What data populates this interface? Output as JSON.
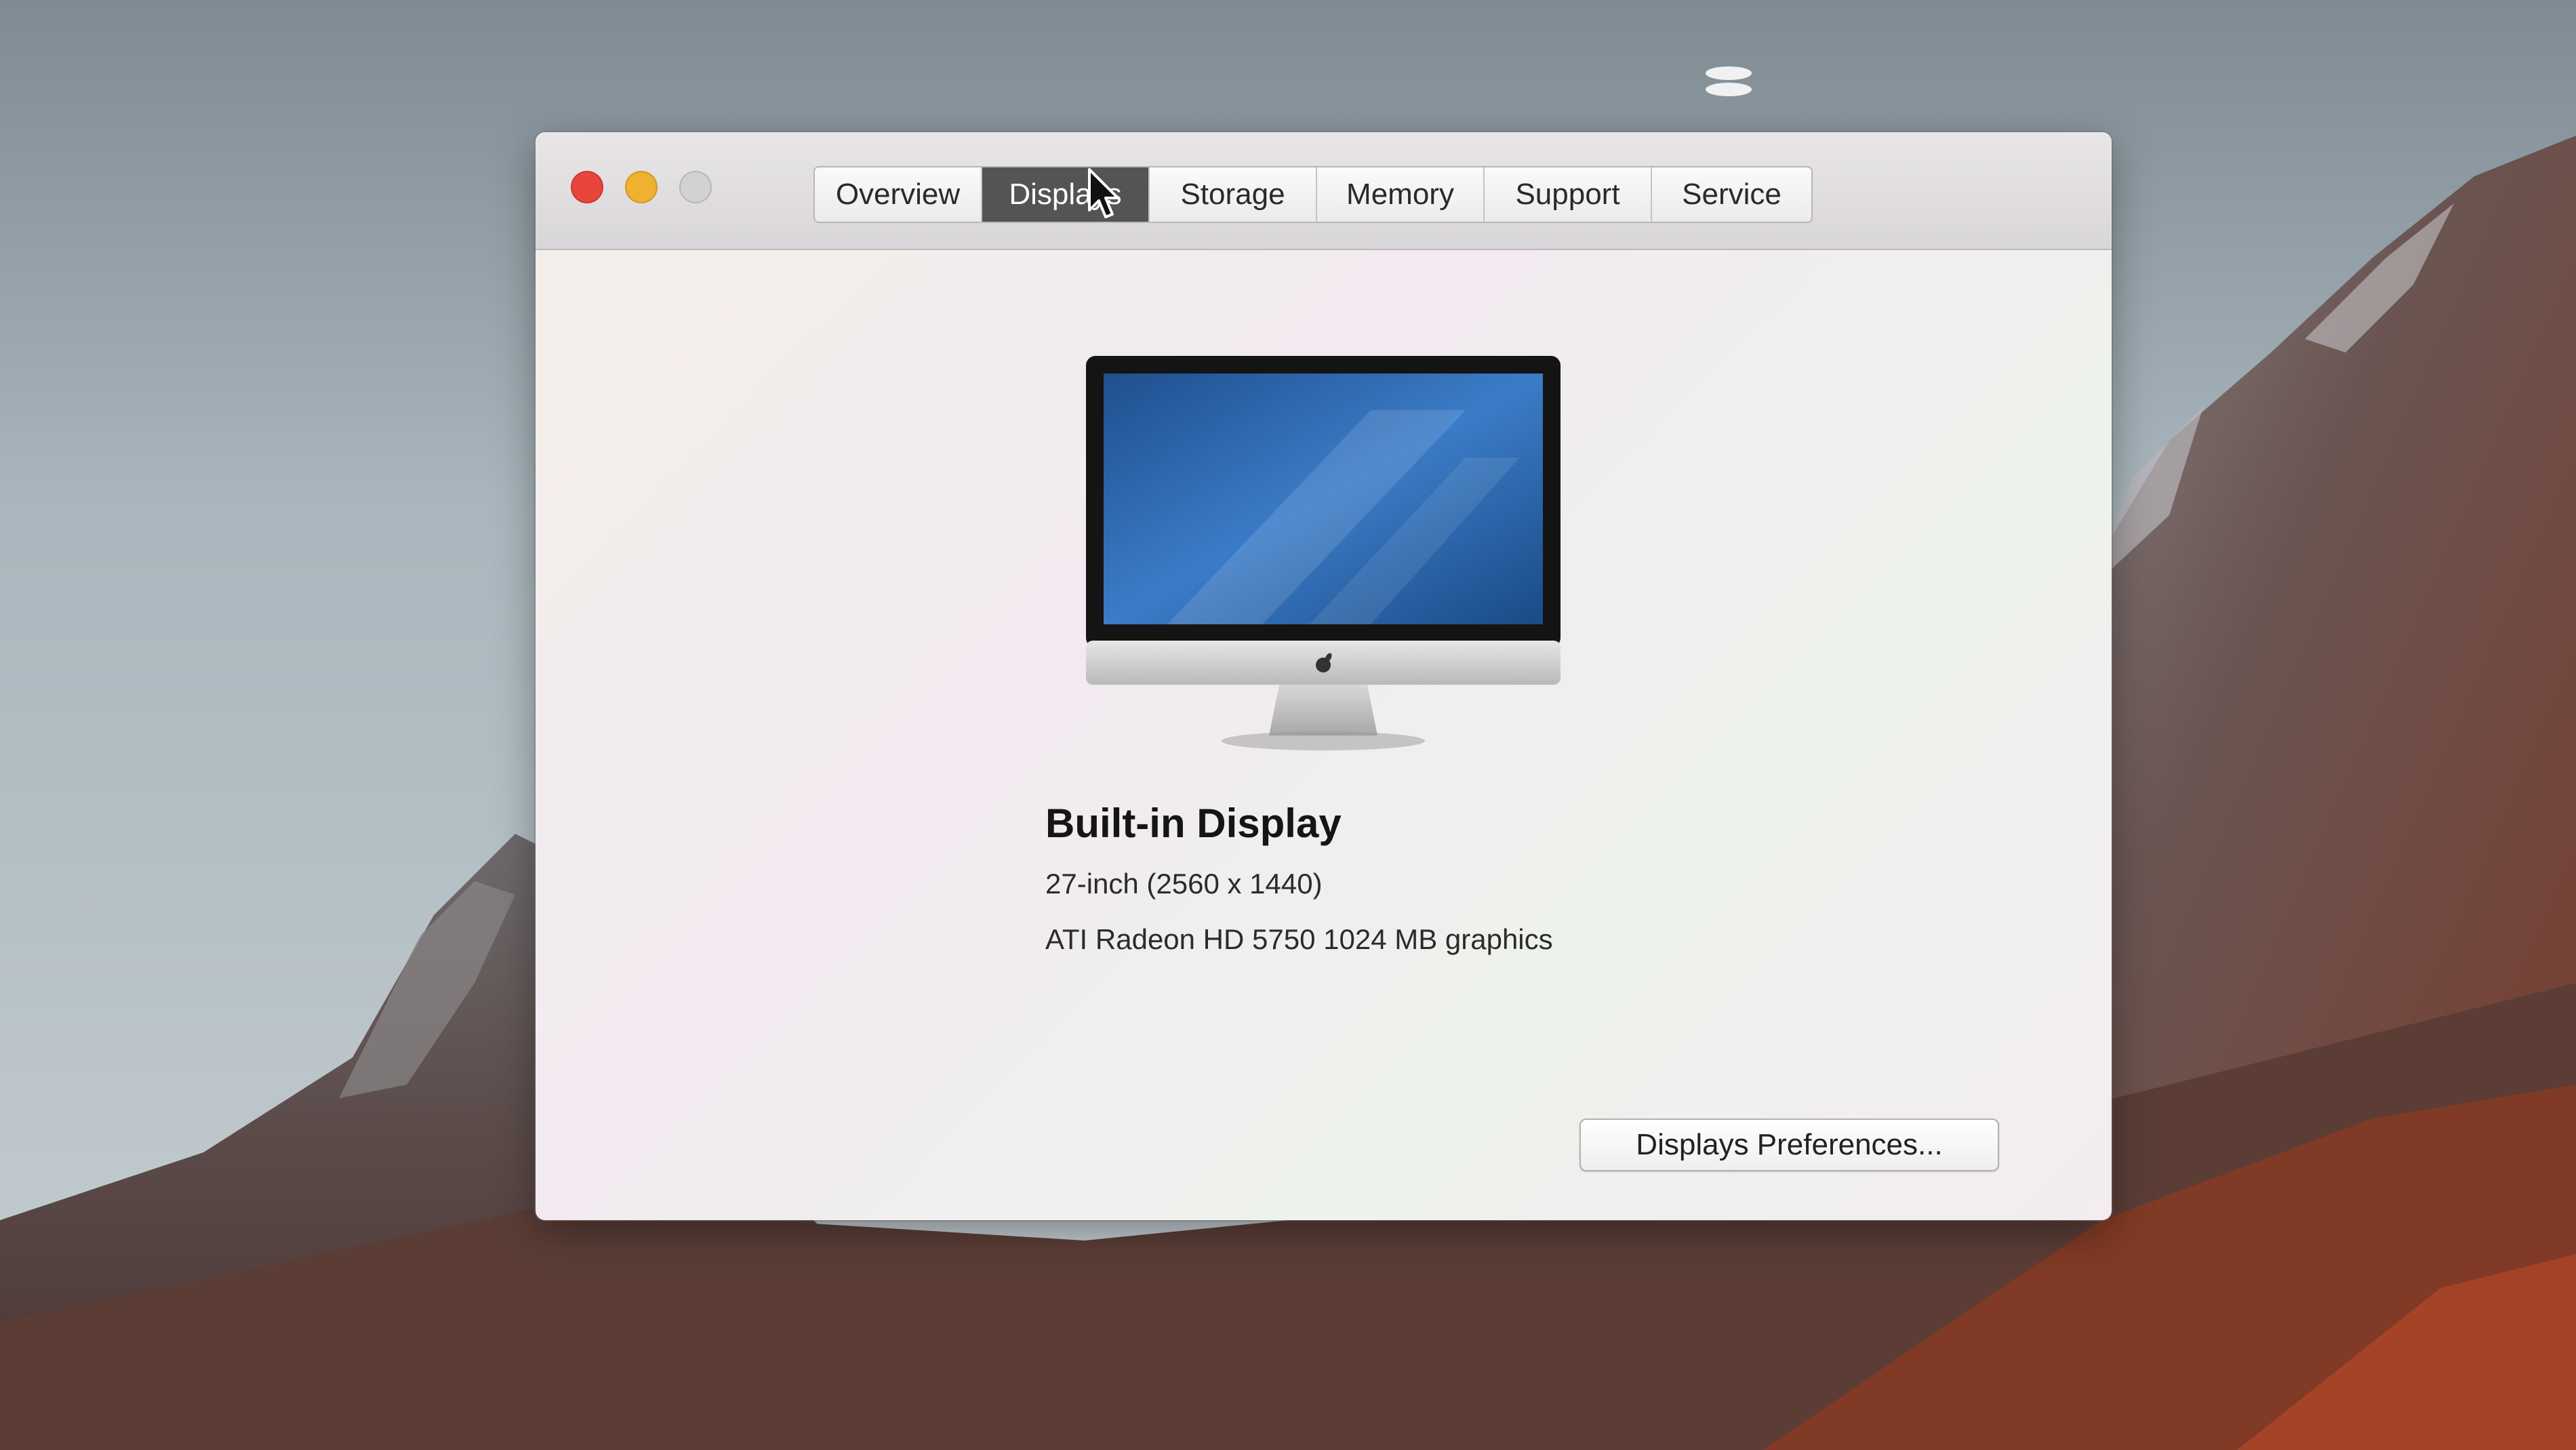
{
  "window": {
    "tabs": [
      {
        "label": "Overview",
        "active": false
      },
      {
        "label": "Displays",
        "active": true
      },
      {
        "label": "Storage",
        "active": false
      },
      {
        "label": "Memory",
        "active": false
      },
      {
        "label": "Support",
        "active": false
      },
      {
        "label": "Service",
        "active": false
      }
    ]
  },
  "display": {
    "name": "Built-in Display",
    "size": "27-inch (2560 x 1440)",
    "graphics": "ATI Radeon HD 5750 1024 MB graphics"
  },
  "actions": {
    "preferences_label": "Displays Preferences..."
  },
  "colors": {
    "close": "#e8453c",
    "minimize": "#f0b030",
    "zoom": "#d4d1d3",
    "active_tab": "#545356"
  },
  "icons": {
    "close": "close-icon",
    "minimize": "minimize-icon",
    "zoom": "zoom-icon",
    "cursor": "pointer-cursor-icon",
    "display": "imac-display-icon",
    "apple": "apple-logo-icon"
  }
}
